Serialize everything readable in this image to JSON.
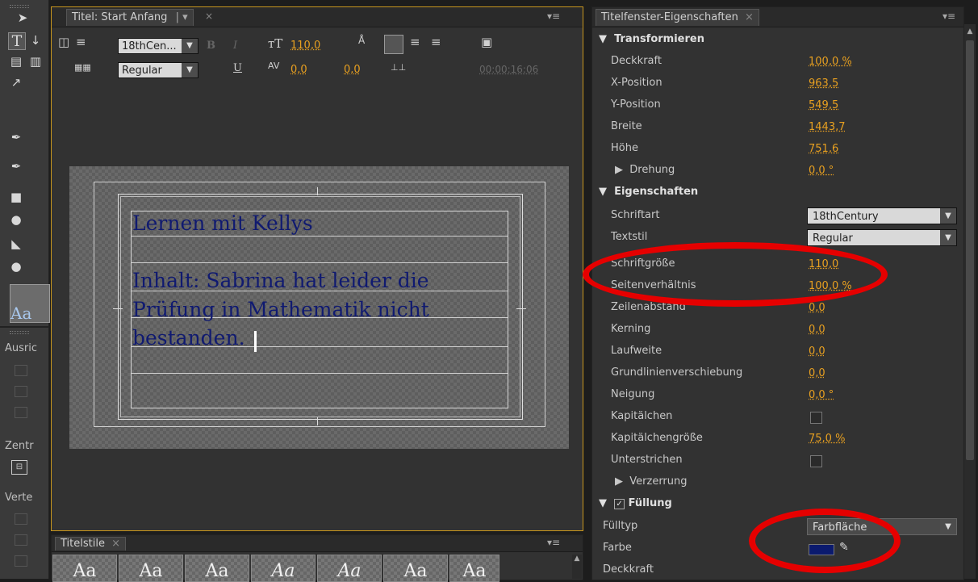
{
  "title_panel": {
    "tab_label": "Titel: Start Anfang",
    "font_name": "18thCen...",
    "font_style": "Regular",
    "font_size": "110,0",
    "kerning": "0,0",
    "leading": "0,0",
    "timecode": "00:00:16:06",
    "text_line1": "Lernen mit Kellys",
    "text_line2": "Inhalt: Sabrina hat leider die",
    "text_line3": "Prüfung in Mathematik nicht",
    "text_line4": "bestanden."
  },
  "left_tools": {
    "align_label": "Ausric",
    "center_label": "Zentr",
    "distribute_label": "Verte"
  },
  "styles_panel": {
    "tab_label": "Titelstile",
    "sample_glyph": "Aa"
  },
  "properties": {
    "tab_label": "Titelfenster-Eigenschaften",
    "sections": {
      "transform": "Transformieren",
      "properties": "Eigenschaften",
      "fill": "Füllung"
    },
    "rows": {
      "deckkraft_label": "Deckkraft",
      "deckkraft_value": "100,0 %",
      "xpos_label": "X-Position",
      "xpos_value": "963,5",
      "ypos_label": "Y-Position",
      "ypos_value": "549,5",
      "breite_label": "Breite",
      "breite_value": "1443,7",
      "hoehe_label": "Höhe",
      "hoehe_value": "751,6",
      "drehung_label": "Drehung",
      "drehung_value": "0,0 °",
      "schriftart_label": "Schriftart",
      "schriftart_value": "18thCentury",
      "textstil_label": "Textstil",
      "textstil_value": "Regular",
      "schriftgroesse_label": "Schriftgröße",
      "schriftgroesse_value": "110,0",
      "seitenverhaeltnis_label": "Seitenverhältnis",
      "seitenverhaeltnis_value": "100,0 %",
      "zeilenabstand_label": "Zeilenabstand",
      "zeilenabstand_value": "0,0",
      "kerning_label": "Kerning",
      "kerning_value": "0,0",
      "laufweite_label": "Laufweite",
      "laufweite_value": "0,0",
      "grundlinie_label": "Grundlinienverschiebung",
      "grundlinie_value": "0,0",
      "neigung_label": "Neigung",
      "neigung_value": "0,0 °",
      "kapitaelchen_label": "Kapitälchen",
      "kapitaelchengroesse_label": "Kapitälchengröße",
      "kapitaelchengroesse_value": "75,0 %",
      "unterstrichen_label": "Unterstrichen",
      "verzerrung_label": "Verzerrung",
      "fuelltyp_label": "Fülltyp",
      "fuelltyp_value": "Farbfläche",
      "farbe_label": "Farbe",
      "fill_deckkraft_label": "Deckkraft"
    },
    "fill_color": "#0b1a6e"
  },
  "colors": {
    "accent_value": "#e8a020",
    "active_border": "#c8961e",
    "annotation_red": "#e60000",
    "title_text": "#101a70"
  }
}
